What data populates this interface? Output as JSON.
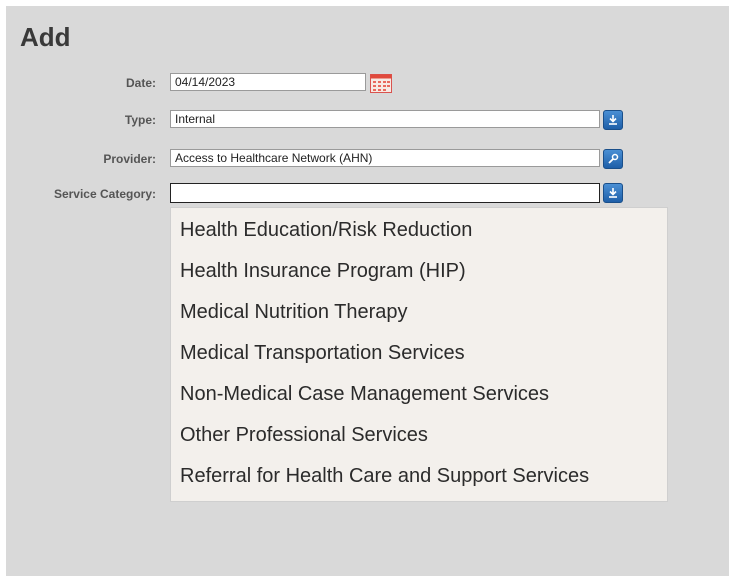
{
  "page": {
    "title": "Add"
  },
  "form": {
    "date": {
      "label": "Date:",
      "value": "04/14/2023"
    },
    "type": {
      "label": "Type:",
      "value": "Internal"
    },
    "provider": {
      "label": "Provider:",
      "value": "Access to Healthcare Network (AHN)"
    },
    "service_category": {
      "label": "Service Category:",
      "value": ""
    }
  },
  "dropdown": {
    "options": [
      "Health Education/Risk Reduction",
      "Health Insurance Program (HIP)",
      "Medical Nutrition Therapy",
      "Medical Transportation Services",
      "Non-Medical Case Management Services",
      "Other Professional Services",
      "Referral for Health Care and Support Services"
    ]
  },
  "icons": {
    "date": "calendar-icon",
    "type": "download-arrow-icon",
    "provider": "search-key-icon",
    "service_category": "download-arrow-icon"
  },
  "colors": {
    "panel_bg": "#d9d9d9",
    "button_blue": "#2a6fba",
    "dropdown_bg": "#f3f0ec"
  }
}
